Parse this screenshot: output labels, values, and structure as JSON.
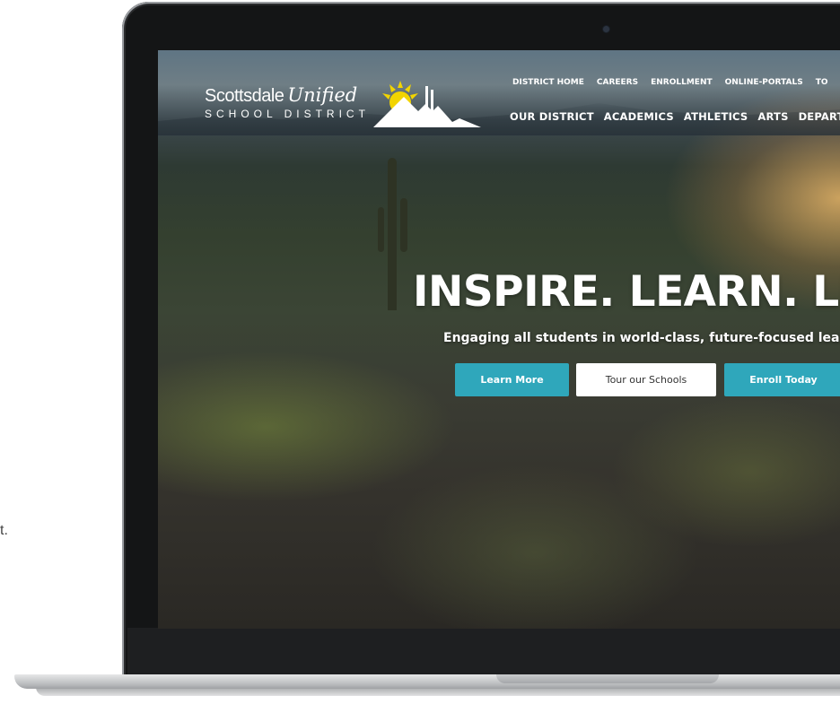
{
  "stray_text": "t.",
  "site": {
    "logo": {
      "name_main": "Scottsdale",
      "name_script": "Unified",
      "name_sub": "SCHOOL DISTRICT"
    },
    "nav_top": [
      "DISTRICT HOME",
      "CAREERS",
      "ENROLLMENT",
      "ONLINE-PORTALS",
      "TO"
    ],
    "nav_main": [
      "OUR DISTRICT",
      "ACADEMICS",
      "ATHLETICS",
      "ARTS",
      "DEPARTMEN"
    ]
  },
  "hero": {
    "title": "INSPIRE. LEARN. LEA",
    "subtitle": "Engaging all students in world-class, future-focused learnin",
    "buttons": {
      "learn_more": "Learn More",
      "tour": "Tour our Schools",
      "enroll": "Enroll Today"
    }
  },
  "colors": {
    "accent_teal": "#2fa7bb",
    "laptop_bezel": "#141516",
    "logo_sun": "#f2d400"
  },
  "icons": [
    "sun-mountain-logo",
    "webcam"
  ]
}
